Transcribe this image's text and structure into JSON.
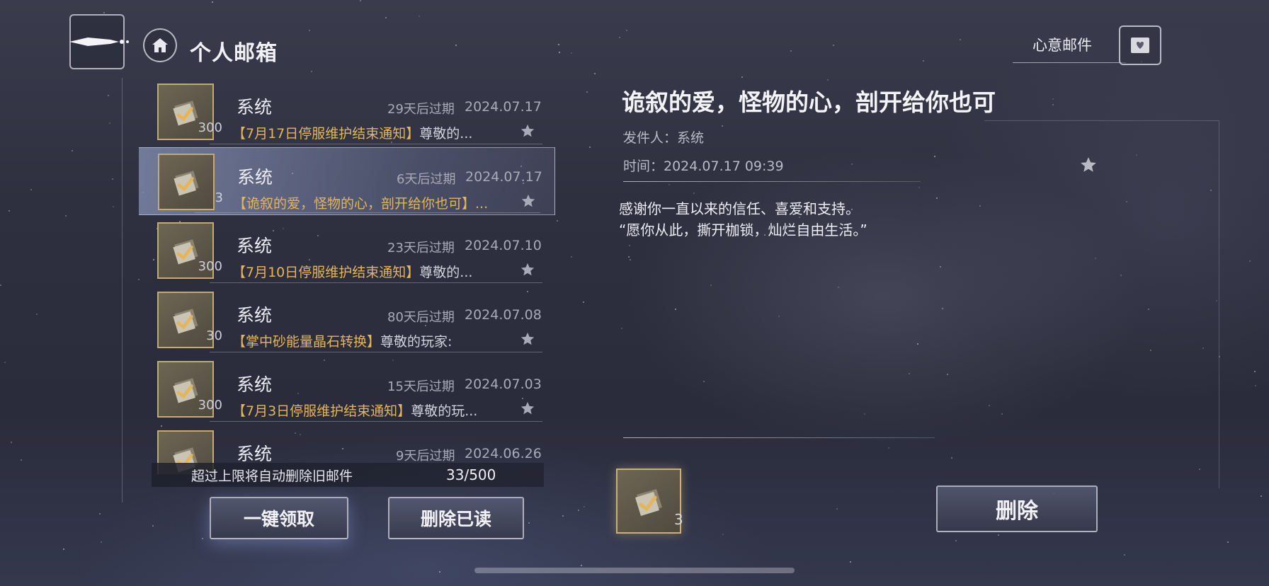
{
  "header": {
    "title": "个人邮箱",
    "heart_mail_label": "心意邮件"
  },
  "mails": [
    {
      "sender": "系统",
      "expire": "29天后过期",
      "date": "2024.07.17",
      "count": "300",
      "subject_hl": "【7月17日停服维护结束通知】",
      "subject_rest": "尊敬的...",
      "selected": false
    },
    {
      "sender": "系统",
      "expire": "6天后过期",
      "date": "2024.07.17",
      "count": "3",
      "subject_hl": "【诡叙的爱，怪物的心，剖开给你也可】...",
      "subject_rest": "",
      "selected": true
    },
    {
      "sender": "系统",
      "expire": "23天后过期",
      "date": "2024.07.10",
      "count": "300",
      "subject_hl": "【7月10日停服维护结束通知】",
      "subject_rest": "尊敬的...",
      "selected": false
    },
    {
      "sender": "系统",
      "expire": "80天后过期",
      "date": "2024.07.08",
      "count": "30",
      "subject_hl": "【掌中砂能量晶石转换】",
      "subject_rest": "尊敬的玩家:",
      "selected": false
    },
    {
      "sender": "系统",
      "expire": "15天后过期",
      "date": "2024.07.03",
      "count": "300",
      "subject_hl": "【7月3日停服维护结束通知】",
      "subject_rest": "尊敬的玩...",
      "selected": false
    },
    {
      "sender": "系统",
      "expire": "9天后过期",
      "date": "2024.06.26",
      "count": "",
      "subject_hl": "",
      "subject_rest": "",
      "selected": false
    }
  ],
  "capacity": {
    "text": "超过上限将自动删除旧邮件",
    "count": "33/500"
  },
  "buttons": {
    "claim_all": "一键领取",
    "delete_read": "删除已读",
    "delete": "删除"
  },
  "detail": {
    "title": "诡叙的爱，怪物的心，剖开给你也可",
    "sender_line": "发件人：系统",
    "time_line": "时间：2024.07.17 09:39",
    "body_line1": "感谢你一直以来的信任、喜爱和支持。",
    "body_line2": "“愿你从此，撕开枷锁，灿烂自由生活。”",
    "attachment_count": "3"
  },
  "colors": {
    "accent_gold": "#e6b559",
    "background": "#2e3040"
  }
}
